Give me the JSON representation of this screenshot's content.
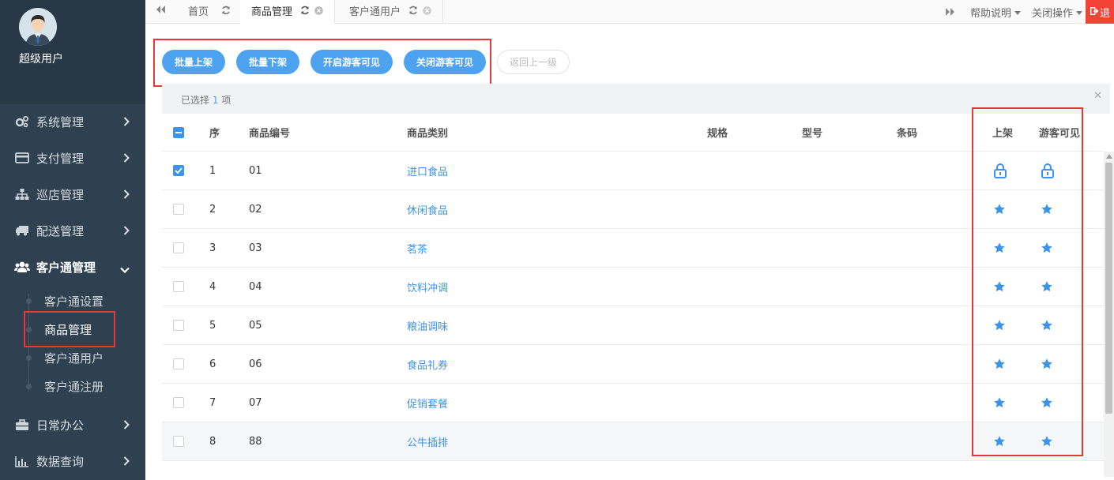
{
  "profile": {
    "name": "超级用户"
  },
  "sidebar": {
    "items": [
      {
        "label": "系统管理",
        "icon": "gears-icon"
      },
      {
        "label": "支付管理",
        "icon": "credit-card-icon"
      },
      {
        "label": "巡店管理",
        "icon": "sitemap-icon"
      },
      {
        "label": "配送管理",
        "icon": "truck-icon"
      },
      {
        "label": "客户通管理",
        "icon": "users-icon"
      },
      {
        "label": "日常办公",
        "icon": "briefcase-icon"
      },
      {
        "label": "数据查询",
        "icon": "bar-chart-icon"
      }
    ],
    "subitems": [
      {
        "label": "客户通设置"
      },
      {
        "label": "商品管理"
      },
      {
        "label": "客户通用户"
      },
      {
        "label": "客户通注册"
      }
    ]
  },
  "tabs": [
    {
      "label": "首页"
    },
    {
      "label": "商品管理"
    },
    {
      "label": "客户通用户"
    }
  ],
  "tab_tools": {
    "help": "帮助说明",
    "close_ops": "关闭操作",
    "logout": "退"
  },
  "toolbar": {
    "batch_on": "批量上架",
    "batch_off": "批量下架",
    "open_guest": "开启游客可见",
    "close_guest": "关闭游客可见",
    "back": "返回上一级"
  },
  "selection": {
    "prefix": "已选择",
    "count": "1",
    "suffix": "项"
  },
  "table": {
    "headers": [
      "序",
      "商品编号",
      "商品类别",
      "规格",
      "型号",
      "条码",
      "上架",
      "游客可见"
    ],
    "rows": [
      {
        "seq": "1",
        "code": "01",
        "category": "进口食品",
        "checked": true,
        "on_icon": "lock-icon",
        "guest_icon": "lock-icon"
      },
      {
        "seq": "2",
        "code": "02",
        "category": "休闲食品",
        "checked": false,
        "on_icon": "star-icon",
        "guest_icon": "star-icon"
      },
      {
        "seq": "3",
        "code": "03",
        "category": "茗茶",
        "checked": false,
        "on_icon": "star-icon",
        "guest_icon": "star-icon"
      },
      {
        "seq": "4",
        "code": "04",
        "category": "饮料冲调",
        "checked": false,
        "on_icon": "star-icon",
        "guest_icon": "star-icon"
      },
      {
        "seq": "5",
        "code": "05",
        "category": "粮油调味",
        "checked": false,
        "on_icon": "star-icon",
        "guest_icon": "star-icon"
      },
      {
        "seq": "6",
        "code": "06",
        "category": "食品礼券",
        "checked": false,
        "on_icon": "star-icon",
        "guest_icon": "star-icon"
      },
      {
        "seq": "7",
        "code": "07",
        "category": "促销套餐",
        "checked": false,
        "on_icon": "star-icon",
        "guest_icon": "star-icon"
      },
      {
        "seq": "8",
        "code": "88",
        "category": "公牛插排",
        "checked": false,
        "on_icon": "star-icon",
        "guest_icon": "star-icon"
      }
    ]
  },
  "colors": {
    "sidebar_bg": "#2f4050",
    "accent": "#4ea3f1",
    "link": "#3d93e8",
    "highlight_box": "#e53935",
    "logout_bg": "#f44336"
  }
}
